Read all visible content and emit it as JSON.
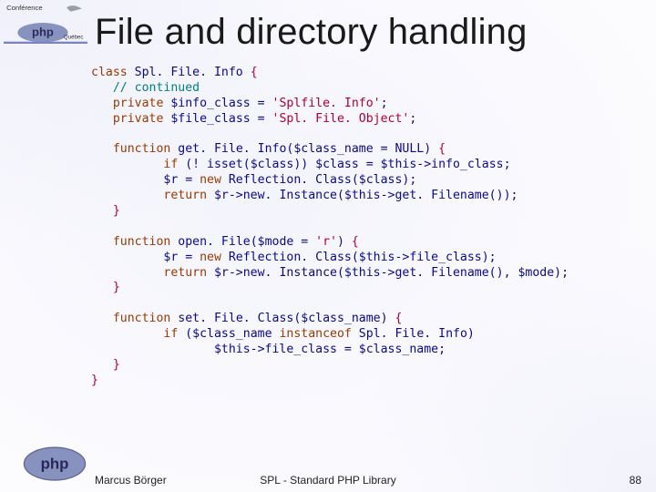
{
  "header": {
    "title": "File and directory handling"
  },
  "logos": {
    "top_label": "Conférence PHP Québec",
    "bottom_label": "php"
  },
  "code": {
    "lines": [
      {
        "t": "kw",
        "s": "class "
      },
      {
        "t": "id",
        "s": "Spl. File. Info "
      },
      {
        "t": "br",
        "s": "{"
      },
      "NL",
      {
        "t": "id",
        "s": "   "
      },
      {
        "t": "com",
        "s": "// continued"
      },
      "NL",
      {
        "t": "id",
        "s": "   "
      },
      {
        "t": "kw",
        "s": "private "
      },
      {
        "t": "id",
        "s": "$info_class = "
      },
      {
        "t": "str",
        "s": "'Splfile. Info'"
      },
      {
        "t": "id",
        "s": ";"
      },
      "NL",
      {
        "t": "id",
        "s": "   "
      },
      {
        "t": "kw",
        "s": "private "
      },
      {
        "t": "id",
        "s": "$file_class = "
      },
      {
        "t": "str",
        "s": "'Spl. File. Object'"
      },
      {
        "t": "id",
        "s": ";"
      },
      "NL",
      "NL",
      {
        "t": "id",
        "s": "   "
      },
      {
        "t": "kw",
        "s": "function "
      },
      {
        "t": "id",
        "s": "get. File. Info($class_name = NULL) "
      },
      {
        "t": "br",
        "s": "{"
      },
      "NL",
      {
        "t": "id",
        "s": "          "
      },
      {
        "t": "kw",
        "s": "if "
      },
      {
        "t": "id",
        "s": "(! isset($class)) $class = $this->info_class;"
      },
      "NL",
      {
        "t": "id",
        "s": "          $r = "
      },
      {
        "t": "kw",
        "s": "new "
      },
      {
        "t": "id",
        "s": "Reflection. Class($class);"
      },
      "NL",
      {
        "t": "id",
        "s": "          "
      },
      {
        "t": "kw",
        "s": "return "
      },
      {
        "t": "id",
        "s": "$r->new. Instance($this->get. Filename());"
      },
      "NL",
      {
        "t": "id",
        "s": "   "
      },
      {
        "t": "br",
        "s": "}"
      },
      "NL",
      "NL",
      {
        "t": "id",
        "s": "   "
      },
      {
        "t": "kw",
        "s": "function "
      },
      {
        "t": "id",
        "s": "open. File($mode = "
      },
      {
        "t": "str",
        "s": "'r'"
      },
      {
        "t": "id",
        "s": ") "
      },
      {
        "t": "br",
        "s": "{"
      },
      "NL",
      {
        "t": "id",
        "s": "          $r = "
      },
      {
        "t": "kw",
        "s": "new "
      },
      {
        "t": "id",
        "s": "Reflection. Class($this->file_class);"
      },
      "NL",
      {
        "t": "id",
        "s": "          "
      },
      {
        "t": "kw",
        "s": "return "
      },
      {
        "t": "id",
        "s": "$r->new. Instance($this->get. Filename(), $mode);"
      },
      "NL",
      {
        "t": "id",
        "s": "   "
      },
      {
        "t": "br",
        "s": "}"
      },
      "NL",
      "NL",
      {
        "t": "id",
        "s": "   "
      },
      {
        "t": "kw",
        "s": "function "
      },
      {
        "t": "id",
        "s": "set. File. Class($class_name) "
      },
      {
        "t": "br",
        "s": "{"
      },
      "NL",
      {
        "t": "id",
        "s": "          "
      },
      {
        "t": "kw",
        "s": "if "
      },
      {
        "t": "id",
        "s": "($class_name "
      },
      {
        "t": "kw",
        "s": "instanceof "
      },
      {
        "t": "id",
        "s": "Spl. File. Info)"
      },
      "NL",
      {
        "t": "id",
        "s": "                 $this->file_class = $class_name;"
      },
      "NL",
      {
        "t": "id",
        "s": "   "
      },
      {
        "t": "br",
        "s": "}"
      },
      "NL",
      {
        "t": "br",
        "s": "}"
      }
    ]
  },
  "footer": {
    "author": "Marcus Börger",
    "center": "SPL - Standard PHP Library",
    "page": "88"
  }
}
